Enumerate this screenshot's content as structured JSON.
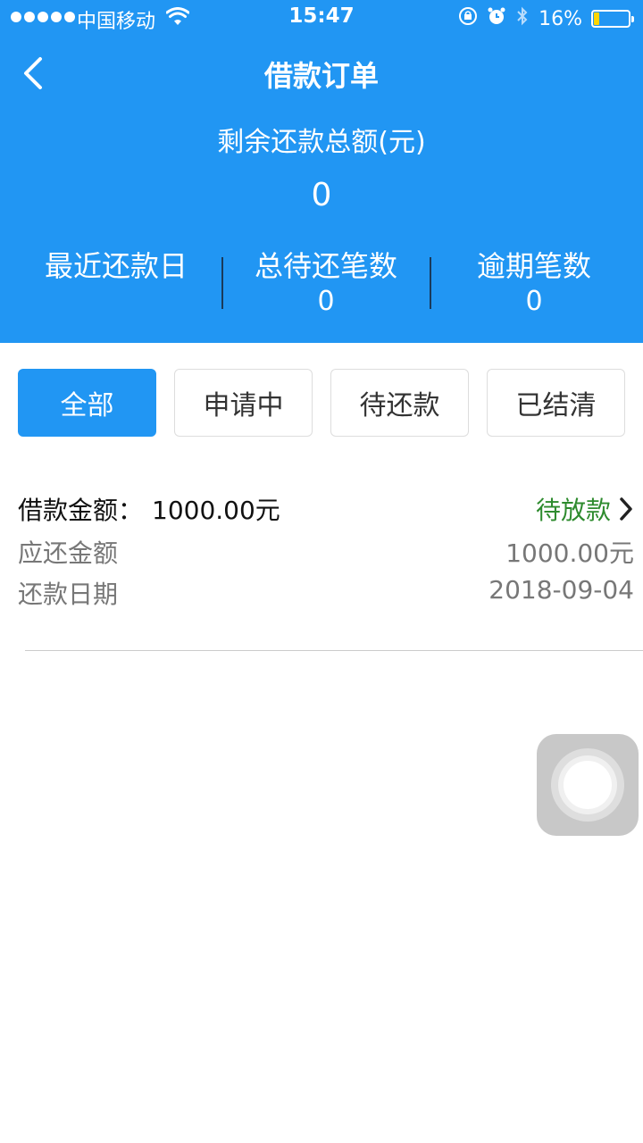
{
  "status_bar": {
    "carrier": "中国移动",
    "time": "15:47",
    "battery": "16%",
    "battery_level": 0.16
  },
  "nav": {
    "title": "借款订单"
  },
  "summary": {
    "label": "剩余还款总额(元)",
    "amount": "0"
  },
  "stats": [
    {
      "label": "最近还款日",
      "value": ""
    },
    {
      "label": "总待还笔数",
      "value": "0"
    },
    {
      "label": "逾期笔数",
      "value": "0"
    }
  ],
  "tabs": [
    {
      "label": "全部",
      "active": true
    },
    {
      "label": "申请中",
      "active": false
    },
    {
      "label": "待还款",
      "active": false
    },
    {
      "label": "已结清",
      "active": false
    }
  ],
  "order": {
    "amount_label": "借款金额：",
    "amount_value": "1000.00元",
    "status": "待放款",
    "repay_label": "应还金额",
    "repay_value": "1000.00元",
    "date_label": "还款日期",
    "date_value": "2018-09-04"
  },
  "colors": {
    "primary": "#2196f3",
    "status_green": "#2e8b2e"
  }
}
